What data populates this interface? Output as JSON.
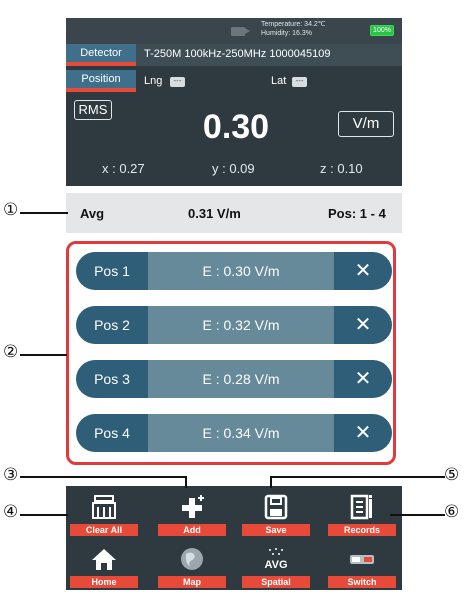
{
  "status": {
    "temperature": "Temperature: 34.2℃",
    "humidity": "Humidity: 16.3%",
    "battery": "100%"
  },
  "detector": {
    "label": "Detector",
    "value": "T-250M 100kHz-250MHz 1000045109"
  },
  "position": {
    "label": "Position",
    "lng_label": "Lng",
    "lng_value": "---",
    "lat_label": "Lat",
    "lat_value": "---"
  },
  "measurement": {
    "mode": "RMS",
    "value": "0.30",
    "unit": "V/m",
    "x": "x : 0.27",
    "y": "y : 0.09",
    "z": "z : 0.10"
  },
  "avg": {
    "label": "Avg",
    "value": "0.31 V/m",
    "pos": "Pos: 1 - 4"
  },
  "positions": [
    {
      "name": "Pos 1",
      "e": "E : 0.30 V/m",
      "remove": "✕"
    },
    {
      "name": "Pos 2",
      "e": "E : 0.32 V/m",
      "remove": "✕"
    },
    {
      "name": "Pos 3",
      "e": "E : 0.28 V/m",
      "remove": "✕"
    },
    {
      "name": "Pos 4",
      "e": "E : 0.34 V/m",
      "remove": "✕"
    }
  ],
  "toolbar": {
    "clear_all": "Clear All",
    "add": "Add",
    "save": "Save",
    "records": "Records",
    "home": "Home",
    "map": "Map",
    "spatial": "Spatial",
    "switch": "Switch",
    "spatial_icon_text": "AVG"
  },
  "callouts": {
    "c1": "①",
    "c2": "②",
    "c3": "③",
    "c4": "④",
    "c5": "⑤",
    "c6": "⑥"
  },
  "colors": {
    "accent": "#e84a3a",
    "panel": "#2f3a40",
    "pos_dark": "#2f5f78",
    "pos_mid": "#668a9a",
    "highlight": "#e23a3a"
  }
}
